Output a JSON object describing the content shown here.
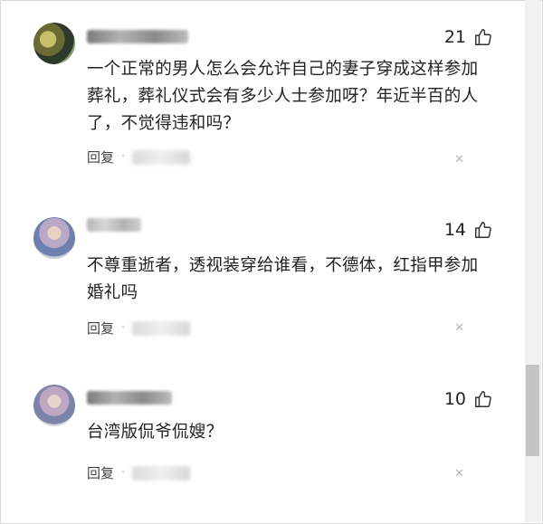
{
  "comments": [
    {
      "likes": "21",
      "text": "一个正常的男人怎么会允许自己的妻子穿成这样参加葬礼，葬礼仪式会有多少人士参加呀？年近半百的人了，不觉得违和吗？",
      "reply_label": "回复",
      "dot": "·"
    },
    {
      "likes": "14",
      "text": "不尊重逝者，透视装穿给谁看，不德体，红指甲参加婚礼吗",
      "reply_label": "回复",
      "dot": "·"
    },
    {
      "likes": "10",
      "text": "台湾版侃爷侃嫂？",
      "reply_label": "回复",
      "dot": "·"
    }
  ],
  "icons": {
    "thumb": "thumb-up-icon",
    "close": "close-icon"
  }
}
